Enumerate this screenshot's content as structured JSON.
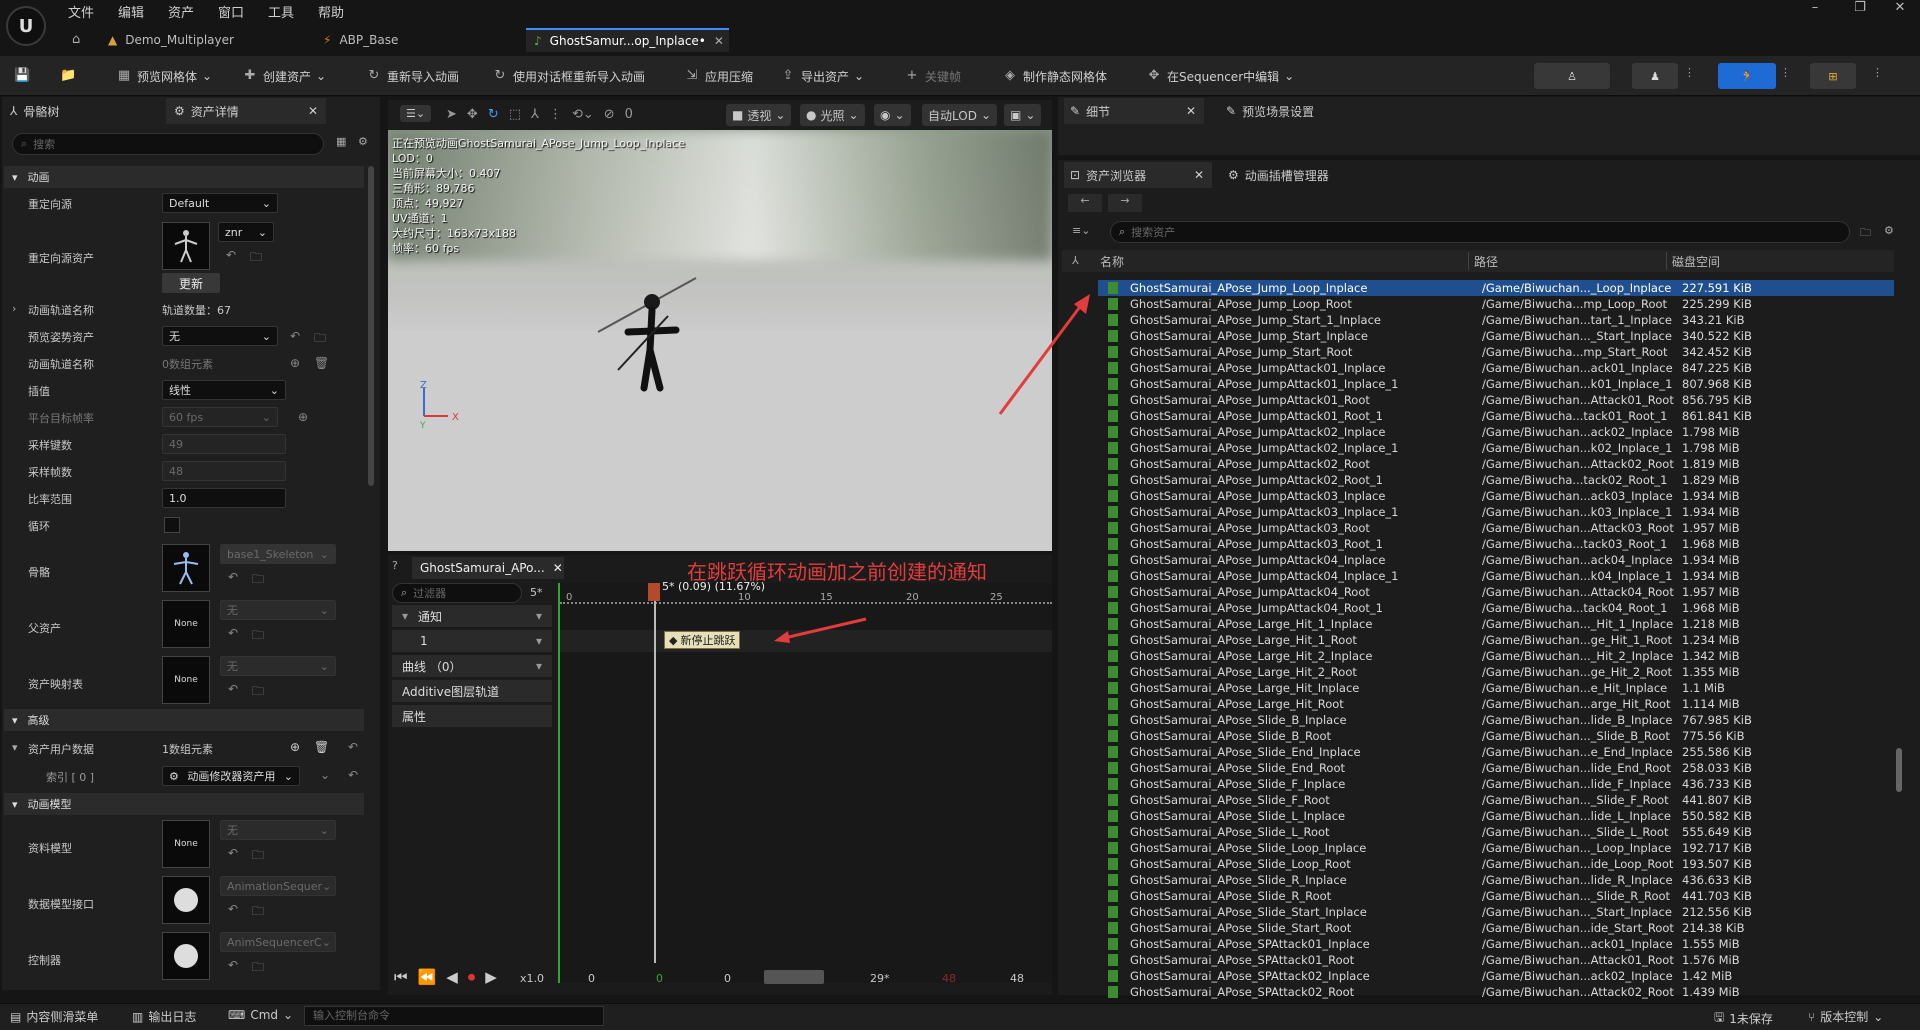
{
  "menu": {
    "items": [
      "文件",
      "编辑",
      "资产",
      "窗口",
      "工具",
      "帮助"
    ]
  },
  "tabs": [
    {
      "label": "Demo_Multiplayer"
    },
    {
      "label": "ABP_Base"
    },
    {
      "label": "GhostSamur...op_Inplace•"
    }
  ],
  "toolbar": {
    "preview_mesh": "预览网格体",
    "create_asset": "创建资产",
    "reimport": "重新导入动画",
    "reimport_dialog": "使用对话框重新导入动画",
    "apply_compression": "应用压缩",
    "export_asset": "导出资产",
    "keyframe": "关键帧",
    "make_static_mesh": "制作静态网格体",
    "edit_in_sequencer": "在Sequencer中编辑"
  },
  "left_panel": {
    "tab_skeleton": "骨骼树",
    "tab_details": "资产详情",
    "search_placeholder": "搜索",
    "section_animation": "动画",
    "retarget_source_label": "重定向源",
    "retarget_source_value": "Default",
    "retarget_asset_label": "重定向源资产",
    "retarget_asset_sub": "znr",
    "update_button": "更新",
    "track_names_label": "动画轨道名称",
    "track_count": "轨道数量：67",
    "preview_pose_label": "预览姿势资产",
    "preview_pose_value": "无",
    "track_name_label": "动画轨道名称",
    "track_name_value": "0数组元素",
    "interp_label": "插值",
    "interp_value": "线性",
    "platform_fps_label": "平台目标帧率",
    "platform_fps_value": "60 fps",
    "sample_keys_label": "采样键数",
    "sample_keys_value": "49",
    "sample_frames_label": "采样帧数",
    "sample_frames_value": "48",
    "rate_scale_label": "比率范围",
    "rate_scale_value": "1.0",
    "loop_label": "循环",
    "skeleton_label": "骨骼",
    "skeleton_value": "base1_Skeleton",
    "parent_label": "父资产",
    "parent_value": "无",
    "asset_mapping_label": "资产映射表",
    "asset_mapping_value": "无",
    "none_thumb": "None",
    "section_advanced": "高级",
    "user_data_label": "资产用户数据",
    "user_data_value": "1数组元素",
    "index_label": "索引 [ 0 ]",
    "index_value": "动画修改器资产用",
    "section_anim_model": "动画模型",
    "data_model_label": "资料模型",
    "data_model_value": "无",
    "data_interface_label": "数据模型接口",
    "data_interface_value": "AnimationSequer",
    "controller_label": "控制器",
    "controller_value": "AnimSequencerC"
  },
  "viewport": {
    "perspective": "透视",
    "lighting": "光照",
    "auto_lod": "自动LOD",
    "rotation_snap": "0",
    "info_lines": [
      "正在预览动画GhostSamurai_APose_Jump_Loop_Inplace",
      "LOD：0",
      "当前屏幕大小：0.407",
      "三角形：89,786",
      "顶点：49,927",
      "UV通道：1",
      "大约尺寸：163x73x188",
      "帧率：60 fps"
    ]
  },
  "timeline": {
    "tab": "GhostSamurai_APo...",
    "filter_placeholder": "过滤器",
    "frame_marker": "5*",
    "playhead_label": "5* (0.09) (11.67%)",
    "ticks": [
      "0",
      "10",
      "15",
      "20",
      "25"
    ],
    "track_notify": "通知",
    "track_1": "1",
    "track_curves": "曲线 （0）",
    "track_additive": "Additive图层轨道",
    "track_attributes": "属性",
    "notify_label": "新停止跳跃",
    "speed": "x1.0",
    "frame_start": "0",
    "frame_green": "0",
    "frame_current": "0",
    "frame_end_marker": "29*",
    "frame_red": "48",
    "frame_total": "48"
  },
  "annotation": "在跳跃循环动画加之前创建的通知",
  "detail_panel": {
    "tab_details": "细节",
    "tab_preview_settings": "预览场景设置"
  },
  "asset_browser": {
    "tab_browser": "资产浏览器",
    "tab_slot_manager": "动画插槽管理器",
    "search_placeholder": "搜索资产",
    "col_name": "名称",
    "col_path": "路径",
    "col_size": "磁盘空间",
    "rows": [
      {
        "name": "GhostSamurai_APose_Jump_Loop_Inplace",
        "path": "/Game/Biwuchan..._Loop_Inplace",
        "size": "227.591 KiB",
        "selected": true
      },
      {
        "name": "GhostSamurai_APose_Jump_Loop_Root",
        "path": "/Game/Biwucha...mp_Loop_Root",
        "size": "225.299 KiB"
      },
      {
        "name": "GhostSamurai_APose_Jump_Start_1_Inplace",
        "path": "/Game/Biwuchan...tart_1_Inplace",
        "size": "343.21 KiB"
      },
      {
        "name": "GhostSamurai_APose_Jump_Start_Inplace",
        "path": "/Game/Biwuchan..._Start_Inplace",
        "size": "340.522 KiB"
      },
      {
        "name": "GhostSamurai_APose_Jump_Start_Root",
        "path": "/Game/Biwucha...mp_Start_Root",
        "size": "342.452 KiB"
      },
      {
        "name": "GhostSamurai_APose_JumpAttack01_Inplace",
        "path": "/Game/Biwuchan...ack01_Inplace",
        "size": "847.225 KiB"
      },
      {
        "name": "GhostSamurai_APose_JumpAttack01_Inplace_1",
        "path": "/Game/Biwuchan...k01_Inplace_1",
        "size": "807.968 KiB"
      },
      {
        "name": "GhostSamurai_APose_JumpAttack01_Root",
        "path": "/Game/Biwuchan...Attack01_Root",
        "size": "856.795 KiB"
      },
      {
        "name": "GhostSamurai_APose_JumpAttack01_Root_1",
        "path": "/Game/Biwucha...tack01_Root_1",
        "size": "861.841 KiB"
      },
      {
        "name": "GhostSamurai_APose_JumpAttack02_Inplace",
        "path": "/Game/Biwuchan...ack02_Inplace",
        "size": "1.798 MiB"
      },
      {
        "name": "GhostSamurai_APose_JumpAttack02_Inplace_1",
        "path": "/Game/Biwuchan...k02_Inplace_1",
        "size": "1.798 MiB"
      },
      {
        "name": "GhostSamurai_APose_JumpAttack02_Root",
        "path": "/Game/Biwuchan...Attack02_Root",
        "size": "1.819 MiB"
      },
      {
        "name": "GhostSamurai_APose_JumpAttack02_Root_1",
        "path": "/Game/Biwucha...tack02_Root_1",
        "size": "1.829 MiB"
      },
      {
        "name": "GhostSamurai_APose_JumpAttack03_Inplace",
        "path": "/Game/Biwuchan...ack03_Inplace",
        "size": "1.934 MiB"
      },
      {
        "name": "GhostSamurai_APose_JumpAttack03_Inplace_1",
        "path": "/Game/Biwuchan...k03_Inplace_1",
        "size": "1.934 MiB"
      },
      {
        "name": "GhostSamurai_APose_JumpAttack03_Root",
        "path": "/Game/Biwuchan...Attack03_Root",
        "size": "1.957 MiB"
      },
      {
        "name": "GhostSamurai_APose_JumpAttack03_Root_1",
        "path": "/Game/Biwucha...tack03_Root_1",
        "size": "1.968 MiB"
      },
      {
        "name": "GhostSamurai_APose_JumpAttack04_Inplace",
        "path": "/Game/Biwuchan...ack04_Inplace",
        "size": "1.934 MiB"
      },
      {
        "name": "GhostSamurai_APose_JumpAttack04_Inplace_1",
        "path": "/Game/Biwuchan...k04_Inplace_1",
        "size": "1.934 MiB"
      },
      {
        "name": "GhostSamurai_APose_JumpAttack04_Root",
        "path": "/Game/Biwuchan...Attack04_Root",
        "size": "1.957 MiB"
      },
      {
        "name": "GhostSamurai_APose_JumpAttack04_Root_1",
        "path": "/Game/Biwucha...tack04_Root_1",
        "size": "1.968 MiB"
      },
      {
        "name": "GhostSamurai_APose_Large_Hit_1_Inplace",
        "path": "/Game/Biwuchan..._Hit_1_Inplace",
        "size": "1.218 MiB"
      },
      {
        "name": "GhostSamurai_APose_Large_Hit_1_Root",
        "path": "/Game/Biwuchan...ge_Hit_1_Root",
        "size": "1.234 MiB"
      },
      {
        "name": "GhostSamurai_APose_Large_Hit_2_Inplace",
        "path": "/Game/Biwuchan..._Hit_2_Inplace",
        "size": "1.342 MiB"
      },
      {
        "name": "GhostSamurai_APose_Large_Hit_2_Root",
        "path": "/Game/Biwuchan...ge_Hit_2_Root",
        "size": "1.355 MiB"
      },
      {
        "name": "GhostSamurai_APose_Large_Hit_Inplace",
        "path": "/Game/Biwuchan...e_Hit_Inplace",
        "size": "1.1 MiB"
      },
      {
        "name": "GhostSamurai_APose_Large_Hit_Root",
        "path": "/Game/Biwuchan...arge_Hit_Root",
        "size": "1.114 MiB"
      },
      {
        "name": "GhostSamurai_APose_Slide_B_Inplace",
        "path": "/Game/Biwuchan...lide_B_Inplace",
        "size": "767.985 KiB"
      },
      {
        "name": "GhostSamurai_APose_Slide_B_Root",
        "path": "/Game/Biwuchan..._Slide_B_Root",
        "size": "775.56 KiB"
      },
      {
        "name": "GhostSamurai_APose_Slide_End_Inplace",
        "path": "/Game/Biwuchan...e_End_Inplace",
        "size": "255.586 KiB"
      },
      {
        "name": "GhostSamurai_APose_Slide_End_Root",
        "path": "/Game/Biwuchan...lide_End_Root",
        "size": "258.033 KiB"
      },
      {
        "name": "GhostSamurai_APose_Slide_F_Inplace",
        "path": "/Game/Biwuchan...lide_F_Inplace",
        "size": "436.733 KiB"
      },
      {
        "name": "GhostSamurai_APose_Slide_F_Root",
        "path": "/Game/Biwuchan..._Slide_F_Root",
        "size": "441.807 KiB"
      },
      {
        "name": "GhostSamurai_APose_Slide_L_Inplace",
        "path": "/Game/Biwuchan...lide_L_Inplace",
        "size": "550.582 KiB"
      },
      {
        "name": "GhostSamurai_APose_Slide_L_Root",
        "path": "/Game/Biwuchan..._Slide_L_Root",
        "size": "555.649 KiB"
      },
      {
        "name": "GhostSamurai_APose_Slide_Loop_Inplace",
        "path": "/Game/Biwuchan..._Loop_Inplace",
        "size": "192.717 KiB"
      },
      {
        "name": "GhostSamurai_APose_Slide_Loop_Root",
        "path": "/Game/Biwuchan...ide_Loop_Root",
        "size": "193.507 KiB"
      },
      {
        "name": "GhostSamurai_APose_Slide_R_Inplace",
        "path": "/Game/Biwuchan...lide_R_Inplace",
        "size": "436.633 KiB"
      },
      {
        "name": "GhostSamurai_APose_Slide_R_Root",
        "path": "/Game/Biwuchan..._Slide_R_Root",
        "size": "441.703 KiB"
      },
      {
        "name": "GhostSamurai_APose_Slide_Start_Inplace",
        "path": "/Game/Biwuchan..._Start_Inplace",
        "size": "212.556 KiB"
      },
      {
        "name": "GhostSamurai_APose_Slide_Start_Root",
        "path": "/Game/Biwuchan...ide_Start_Root",
        "size": "214.38 KiB"
      },
      {
        "name": "GhostSamurai_APose_SPAttack01_Inplace",
        "path": "/Game/Biwuchan...ack01_Inplace",
        "size": "1.555 MiB"
      },
      {
        "name": "GhostSamurai_APose_SPAttack01_Root",
        "path": "/Game/Biwuchan...Attack01_Root",
        "size": "1.576 MiB"
      },
      {
        "name": "GhostSamurai_APose_SPAttack02_Inplace",
        "path": "/Game/Biwuchan...ack02_Inplace",
        "size": "1.42 MiB"
      },
      {
        "name": "GhostSamurai_APose_SPAttack02_Root",
        "path": "/Game/Biwuchan...Attack02_Root",
        "size": "1.439 MiB"
      }
    ]
  },
  "statusbar": {
    "content_drawer": "内容侧滑菜单",
    "output_log": "输出日志",
    "cmd": "Cmd",
    "cmd_placeholder": "输入控制台命令",
    "unsaved": "1未保存",
    "source_control": "版本控制"
  },
  "colors": {
    "accent": "#3d8bfd",
    "annotation": "#e23c3c",
    "anim_icon": "#3e8c32",
    "selected_row": "#1f4f8f"
  }
}
